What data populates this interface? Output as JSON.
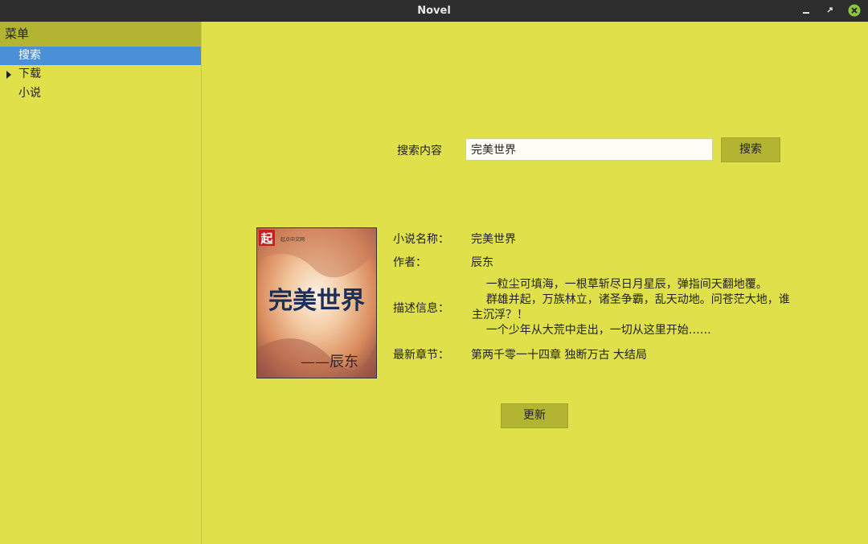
{
  "window": {
    "title": "Novel"
  },
  "sidebar": {
    "header": "菜单",
    "items": [
      {
        "label": "搜索",
        "selected": true
      },
      {
        "label": "下载",
        "expandable": true
      },
      {
        "label": "小说"
      }
    ]
  },
  "search": {
    "label": "搜索内容",
    "value": "完美世界",
    "button_label": "搜索"
  },
  "book": {
    "cover_title": "完美世界",
    "cover_author": "——辰东",
    "cover_logo_text": "起",
    "cover_publisher": "起点中文网",
    "name_label": "小说名称：",
    "name": "完美世界",
    "author_label": "作者：",
    "author": "辰东",
    "desc_label": "描述信息：",
    "description": "    一粒尘可填海，一根草斩尽日月星辰，弹指间天翻地覆。\n    群雄并起，万族林立，诸圣争霸，乱天动地。问苍茫大地，谁主沉浮？！\n    一个少年从大荒中走出，一切从这里开始……",
    "latest_label": "最新章节：",
    "latest_chapter": "第两千零一十四章 独断万古 大结局"
  },
  "actions": {
    "update_label": "更新"
  },
  "colors": {
    "background": "#dfe04a",
    "accent": "#b4b433",
    "selection": "#4a90d9",
    "titlebar": "#2d2d2d",
    "close": "#8ec63f"
  }
}
